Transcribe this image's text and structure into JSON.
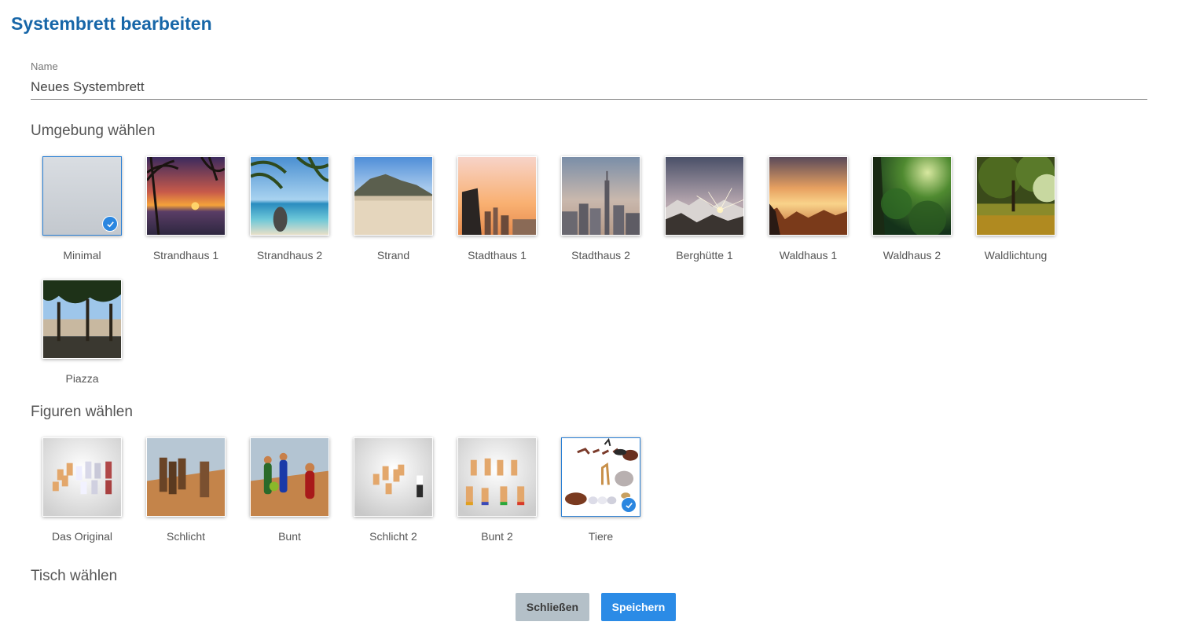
{
  "dialog": {
    "title": "Systembrett bearbeiten"
  },
  "name_field": {
    "label": "Name",
    "value": "Neues Systembrett"
  },
  "environment": {
    "title": "Umgebung wählen",
    "items": [
      {
        "label": "Minimal",
        "selected": true,
        "icon": "minimal-thumbnail"
      },
      {
        "label": "Strandhaus 1",
        "selected": false,
        "icon": "sunset-beach-thumbnail"
      },
      {
        "label": "Strandhaus 2",
        "selected": false,
        "icon": "tropical-beach-thumbnail"
      },
      {
        "label": "Strand",
        "selected": false,
        "icon": "sand-beach-thumbnail"
      },
      {
        "label": "Stadthaus 1",
        "selected": false,
        "icon": "city-sunset-thumbnail"
      },
      {
        "label": "Stadthaus 2",
        "selected": false,
        "icon": "city-skyline-thumbnail"
      },
      {
        "label": "Berghütte 1",
        "selected": false,
        "icon": "mountain-sunrise-thumbnail"
      },
      {
        "label": "Waldhaus 1",
        "selected": false,
        "icon": "forest-sunset-thumbnail"
      },
      {
        "label": "Waldhaus 2",
        "selected": false,
        "icon": "green-forest-thumbnail"
      },
      {
        "label": "Waldlichtung",
        "selected": false,
        "icon": "forest-clearing-thumbnail"
      },
      {
        "label": "Piazza",
        "selected": false,
        "icon": "piazza-pines-thumbnail"
      }
    ]
  },
  "figures": {
    "title": "Figuren wählen",
    "items": [
      {
        "label": "Das Original",
        "selected": false,
        "icon": "original-figures-thumbnail"
      },
      {
        "label": "Schlicht",
        "selected": false,
        "icon": "plain-figures-thumbnail"
      },
      {
        "label": "Bunt",
        "selected": false,
        "icon": "colorful-figures-thumbnail"
      },
      {
        "label": "Schlicht 2",
        "selected": false,
        "icon": "plain2-figures-thumbnail"
      },
      {
        "label": "Bunt 2",
        "selected": false,
        "icon": "colorful2-figures-thumbnail"
      },
      {
        "label": "Tiere",
        "selected": true,
        "icon": "animals-figures-thumbnail"
      }
    ]
  },
  "table": {
    "title": "Tisch wählen"
  },
  "buttons": {
    "close": "Schließen",
    "save": "Speichern"
  },
  "colors": {
    "accent": "#2b8be6",
    "title": "#1766a8",
    "close_button": "#b4c0c8"
  }
}
